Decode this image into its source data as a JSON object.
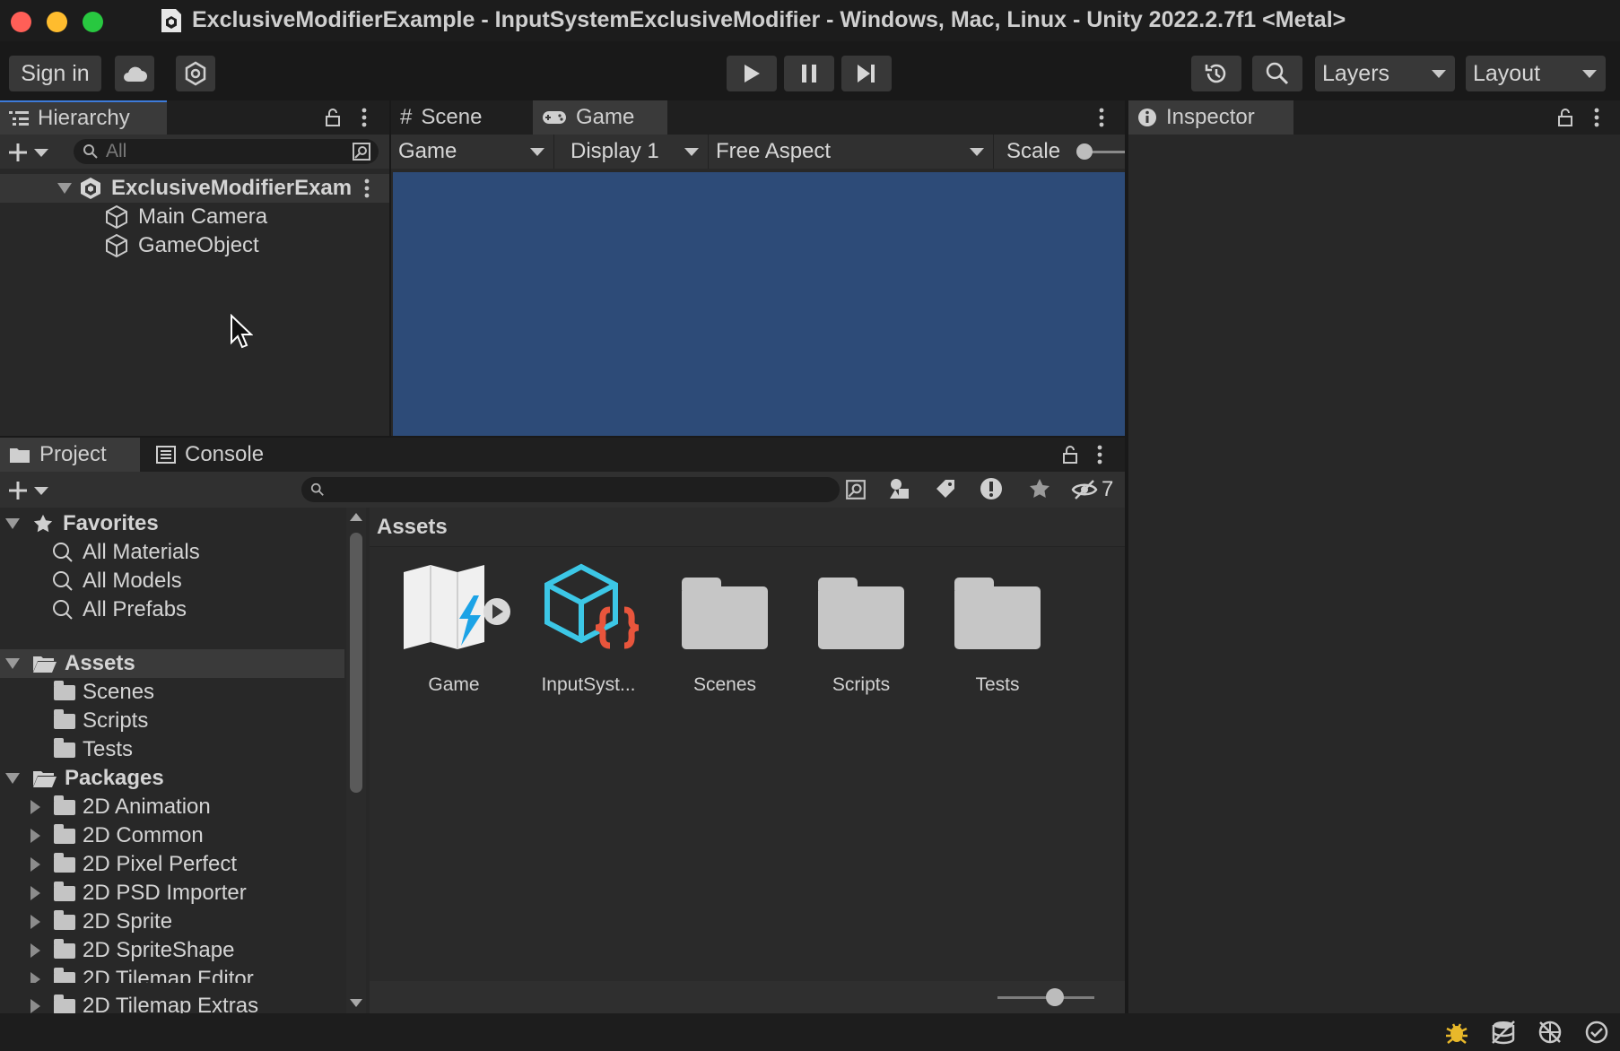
{
  "window": {
    "title": "ExclusiveModifierExample - InputSystemExclusiveModifier - Windows, Mac, Linux - Unity 2022.2.7f1 <Metal>"
  },
  "toolbar": {
    "sign_in": "Sign in",
    "layers": "Layers",
    "layout": "Layout",
    "icons": [
      "cloud-icon",
      "collab-icon",
      "play-icon",
      "pause-icon",
      "step-icon",
      "history-icon",
      "search-icon"
    ]
  },
  "hierarchy": {
    "tab": "Hierarchy",
    "search_placeholder": "All",
    "scene_name": "ExclusiveModifierExam",
    "items": [
      "Main Camera",
      "GameObject"
    ]
  },
  "game_view": {
    "tabs": [
      "Scene",
      "Game"
    ],
    "mode": "Game",
    "display": "Display 1",
    "aspect": "Free Aspect",
    "scale_label": "Scale",
    "background_color": "#2d4b78"
  },
  "inspector": {
    "tab": "Inspector"
  },
  "project": {
    "tabs": [
      "Project",
      "Console"
    ],
    "hidden_count": "7",
    "favorites_label": "Favorites",
    "favorites": [
      "All Materials",
      "All Models",
      "All Prefabs"
    ],
    "assets_label": "Assets",
    "asset_folders": [
      "Scenes",
      "Scripts",
      "Tests"
    ],
    "packages_label": "Packages",
    "packages": [
      "2D Animation",
      "2D Common",
      "2D Pixel Perfect",
      "2D PSD Importer",
      "2D Sprite",
      "2D SpriteShape",
      "2D Tilemap Editor",
      "2D Tilemap Extras"
    ],
    "breadcrumb": "Assets",
    "grid_items": [
      "Game",
      "InputSyst...",
      "Scenes",
      "Scripts",
      "Tests"
    ]
  },
  "colors": {
    "accent_blue": "#2d4b78",
    "panel_bg": "#282828",
    "selection_bg": "#3a3a3a"
  }
}
